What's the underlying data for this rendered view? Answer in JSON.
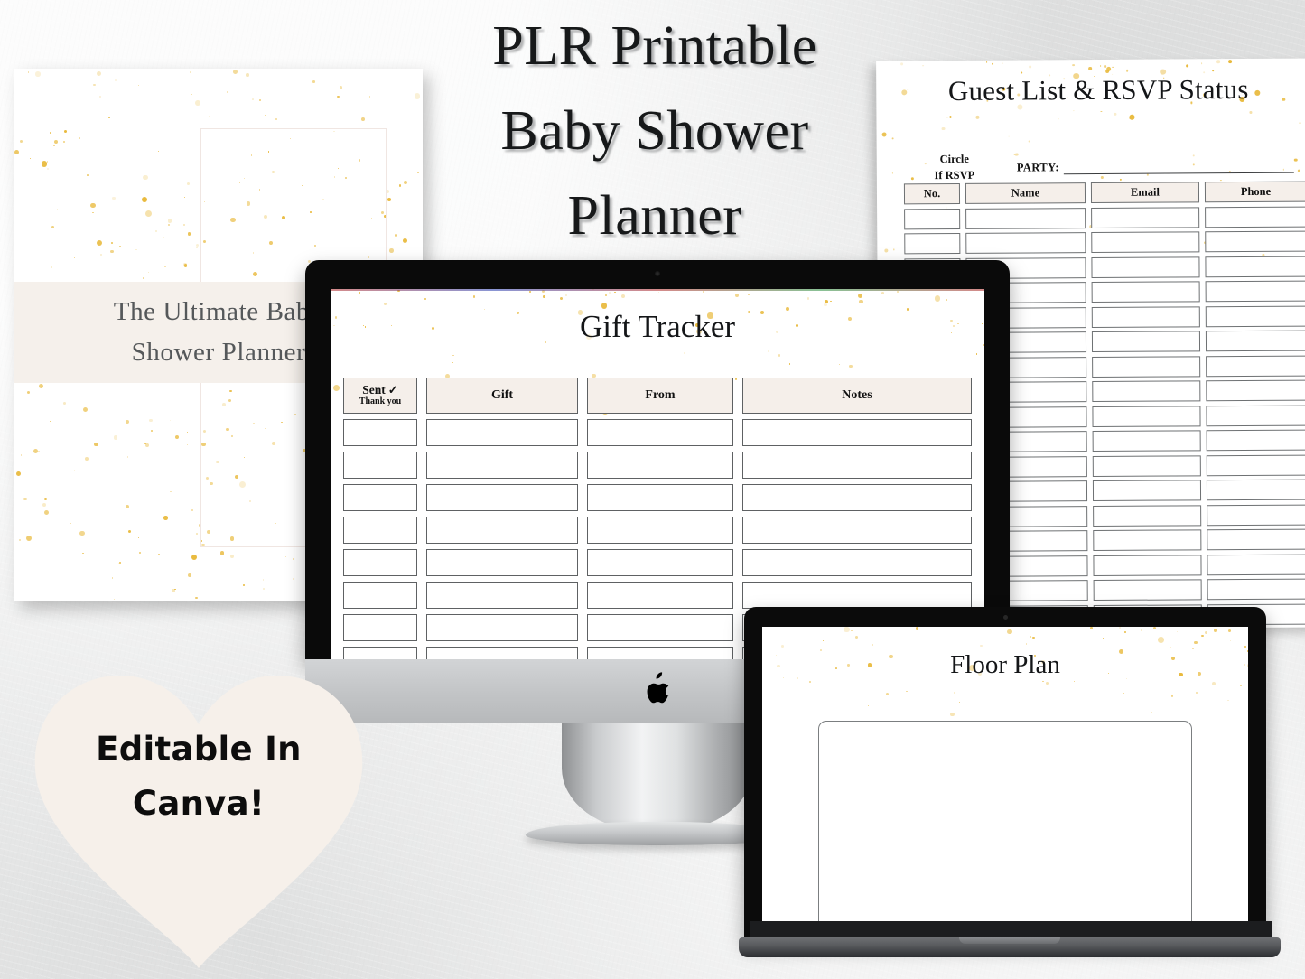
{
  "background": {
    "color": "#e7e8e8"
  },
  "title": {
    "lines": [
      "PLR Printable",
      "Baby Shower",
      "Planner"
    ]
  },
  "left_stack": {
    "caption_lines": [
      "The Ultimate Baby",
      "Shower Planner"
    ],
    "band_color": "#f5f0eb"
  },
  "guest_sheet": {
    "title": "Guest List & RSVP Status",
    "circle_note_lines": [
      "Circle",
      "If RSVP"
    ],
    "party_label": "PARTY:",
    "columns": [
      "No.",
      "Name",
      "Email",
      "Phone"
    ],
    "row_count": 18,
    "header_fill": "#f5efea"
  },
  "imac": {
    "device": "imac",
    "logo": "apple-logo",
    "screen": {
      "title": "Gift Tracker",
      "columns": [
        "Sent",
        "Gift",
        "From",
        "Notes"
      ],
      "sent_sub_label": "Thank you",
      "sent_icon": "check-mark-icon",
      "row_count": 10,
      "header_fill": "#f5efea"
    }
  },
  "macbook": {
    "device": "macbook",
    "screen": {
      "title": "Floor Plan",
      "canvas_area": "floor-plan-blank-box"
    }
  },
  "badge": {
    "shape": "heart",
    "color": "#f6f0ea",
    "lines": [
      "Editable In",
      "Canva!"
    ]
  },
  "accent_colors": {
    "gold_confetti": "#e8b838",
    "cream": "#f5efea",
    "ink": "#141618"
  }
}
